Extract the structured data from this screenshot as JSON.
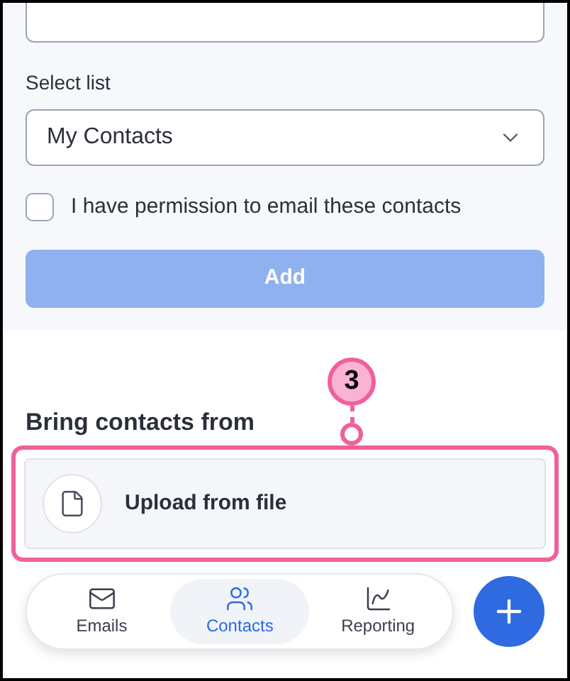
{
  "select_list": {
    "label": "Select list",
    "value": "My Contacts"
  },
  "permission": {
    "label": "I have permission to email these contacts",
    "checked": false
  },
  "add_button": {
    "label": "Add",
    "disabled": true
  },
  "bring_contacts": {
    "heading": "Bring contacts from",
    "options": [
      {
        "label": "Upload from file"
      }
    ]
  },
  "callout": {
    "number": "3"
  },
  "nav": [
    {
      "label": "Emails",
      "kind": "mail",
      "selected": false
    },
    {
      "label": "Contacts",
      "kind": "users",
      "selected": true
    },
    {
      "label": "Reporting",
      "kind": "chart",
      "selected": false
    }
  ]
}
